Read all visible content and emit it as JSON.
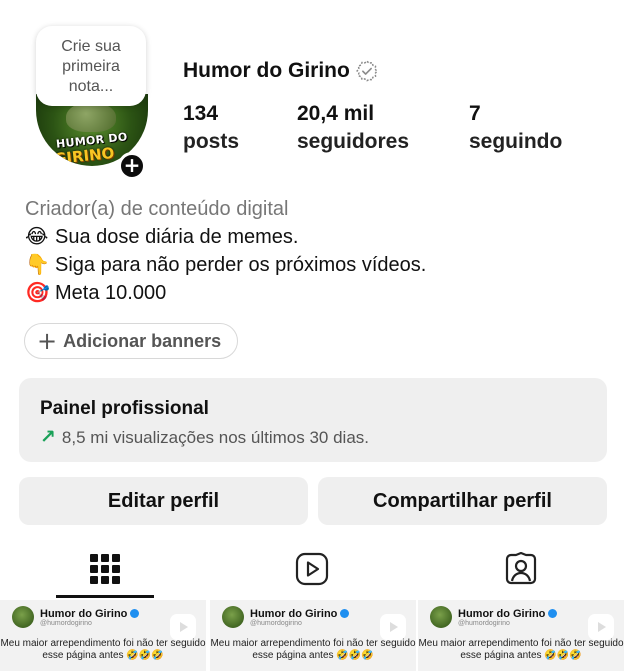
{
  "profile": {
    "note_placeholder": "Crie sua primeira nota...",
    "name": "Humor do Girino",
    "avatar_text_line1": "HUMOR DO",
    "avatar_text_line2": "GIRINO",
    "stats": [
      {
        "value": "134",
        "label": "posts"
      },
      {
        "value": "20,4 mil",
        "label": "seguidores"
      },
      {
        "value": "7",
        "label": "seguindo"
      }
    ]
  },
  "bio": {
    "category": "Criador(a) de conteúdo digital",
    "lines": [
      {
        "emoji": "😂",
        "text": "Sua dose diária de memes."
      },
      {
        "emoji": "👇",
        "text": "Siga para não perder os próximos vídeos."
      },
      {
        "emoji": "🎯",
        "text": "Meta 10.000"
      }
    ]
  },
  "banners": {
    "label": "Adicionar banners"
  },
  "dashboard": {
    "title": "Painel profissional",
    "subtitle": "8,5 mi visualizações nos últimos 30 dias.",
    "trend_color": "#1aa158"
  },
  "actions": {
    "edit": "Editar perfil",
    "share": "Compartilhar perfil"
  },
  "tabs": [
    {
      "icon": "grid-icon",
      "active": true
    },
    {
      "icon": "reels-icon",
      "active": false
    },
    {
      "icon": "tagged-icon",
      "active": false
    }
  ],
  "thumbnails": [
    {
      "name": "Humor do Girino",
      "handle": "@humordogirino",
      "caption": "Meu maior arrependimento foi não ter seguido esse página antes 🤣🤣🤣"
    },
    {
      "name": "Humor do Girino",
      "handle": "@humordogirino",
      "caption": "Meu maior arrependimento foi não ter seguido esse página antes 🤣🤣🤣"
    },
    {
      "name": "Humor do Girino",
      "handle": "@humordogirino",
      "caption": "Meu maior arrependimento foi não ter seguido esse página antes 🤣🤣🤣"
    }
  ]
}
